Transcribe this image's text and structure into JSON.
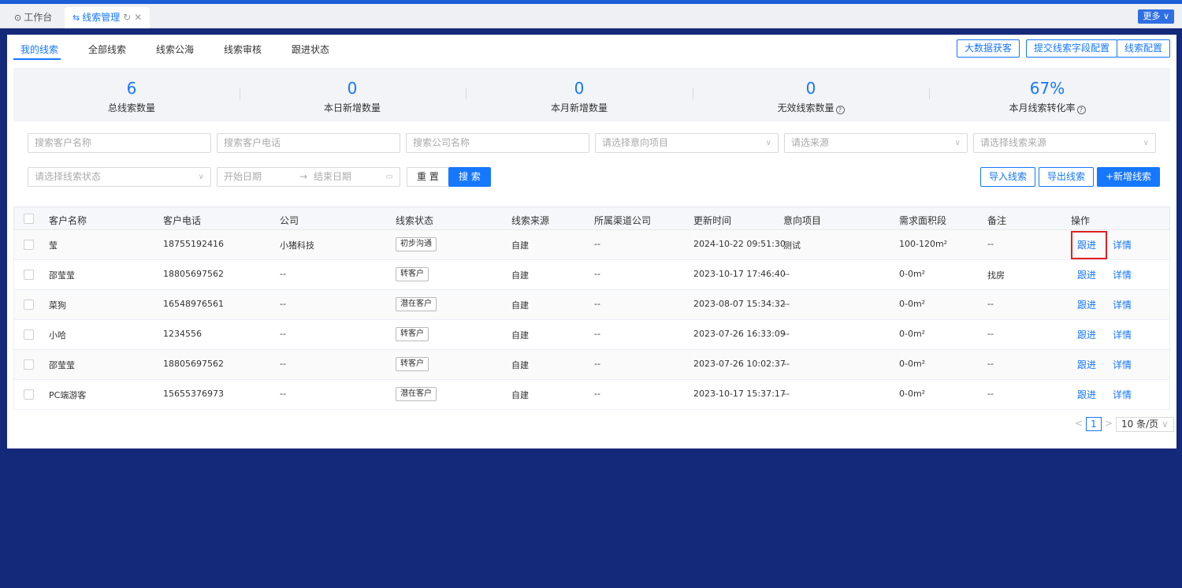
{
  "tabs": {
    "workbench": "工作台",
    "clue_mgmt": "线索管理",
    "more": "更多"
  },
  "subtabs": [
    "我的线索",
    "全部线索",
    "线索公海",
    "线索审核",
    "跟进状态"
  ],
  "top_buttons": [
    "大数据获客",
    "提交线索字段配置",
    "线索配置"
  ],
  "stats": [
    {
      "value": "6",
      "label": "总线索数量",
      "help": false
    },
    {
      "value": "0",
      "label": "本日新增数量",
      "help": false
    },
    {
      "value": "0",
      "label": "本月新增数量",
      "help": false
    },
    {
      "value": "0",
      "label": "无效线索数量",
      "help": true
    },
    {
      "value": "67%",
      "label": "本月线索转化率",
      "help": true
    }
  ],
  "filters": {
    "customer_name": "搜索客户名称",
    "customer_phone": "搜索客户电话",
    "company_name": "搜索公司名称",
    "intent_project": "请选择意向项目",
    "source": "请选来源",
    "clue_source": "请选择线索来源",
    "clue_status": "请选择线索状态",
    "start_date": "开始日期",
    "date_sep": "→",
    "end_date": "结束日期",
    "reset": "重 置",
    "search": "搜 索"
  },
  "actions": {
    "import": "导入线索",
    "export": "导出线索",
    "add": "+新增线索"
  },
  "table": {
    "headers": [
      "客户名称",
      "客户电话",
      "公司",
      "线索状态",
      "线索来源",
      "所属渠道公司",
      "更新时间",
      "意向项目",
      "需求面积段",
      "备注",
      "操作"
    ],
    "rows": [
      {
        "name": "莹",
        "phone": "18755192416",
        "company": "小猪科技",
        "status": "初步沟通",
        "source": "自建",
        "channel": "--",
        "updated": "2024-10-22 09:51:30",
        "project": "测试",
        "area": "100-120m²",
        "note": "--"
      },
      {
        "name": "邵莹莹",
        "phone": "18805697562",
        "company": "--",
        "status": "转客户",
        "source": "自建",
        "channel": "--",
        "updated": "2023-10-17 17:46:40",
        "project": "--",
        "area": "0-0m²",
        "note": "找房"
      },
      {
        "name": "菜狗",
        "phone": "16548976561",
        "company": "--",
        "status": "潜在客户",
        "source": "自建",
        "channel": "--",
        "updated": "2023-08-07 15:34:32",
        "project": "--",
        "area": "0-0m²",
        "note": "--"
      },
      {
        "name": "小哈",
        "phone": "1234556",
        "company": "--",
        "status": "转客户",
        "source": "自建",
        "channel": "--",
        "updated": "2023-07-26 16:33:09",
        "project": "--",
        "area": "0-0m²",
        "note": "--"
      },
      {
        "name": "邵莹莹",
        "phone": "18805697562",
        "company": "--",
        "status": "转客户",
        "source": "自建",
        "channel": "--",
        "updated": "2023-07-26 10:02:37",
        "project": "--",
        "area": "0-0m²",
        "note": "--"
      },
      {
        "name": "PC端游客",
        "phone": "15655376973",
        "company": "--",
        "status": "潜在客户",
        "source": "自建",
        "channel": "--",
        "updated": "2023-10-17 15:37:17",
        "project": "--",
        "area": "0-0m²",
        "note": "--"
      }
    ],
    "op_follow": "跟进",
    "op_detail": "详情"
  },
  "pagination": {
    "current_page": "1",
    "page_size": "10 条/页"
  }
}
